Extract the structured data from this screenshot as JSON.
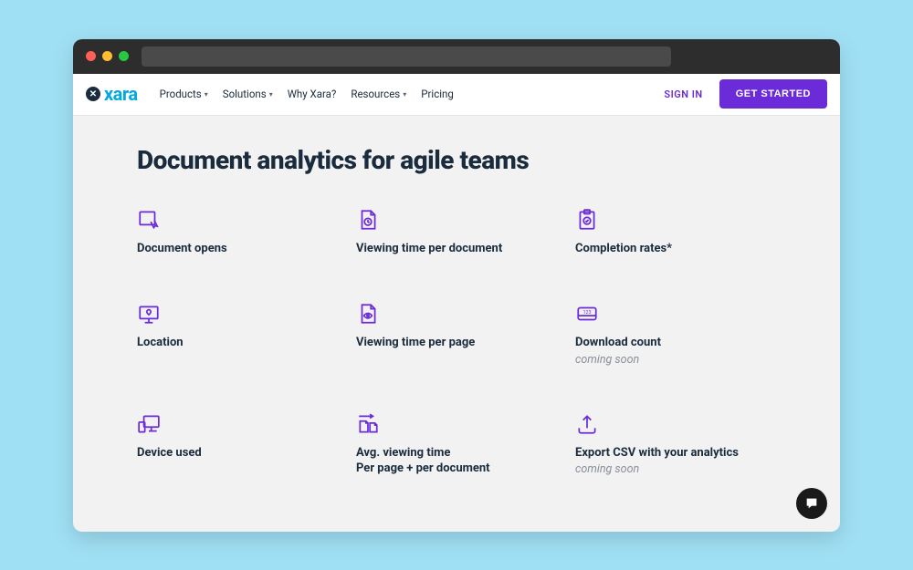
{
  "logo_text": "xara",
  "nav": {
    "products": "Products",
    "solutions": "Solutions",
    "why": "Why Xara?",
    "resources": "Resources",
    "pricing": "Pricing",
    "signin": "SIGN IN",
    "get_started": "GET STARTED"
  },
  "title": "Document analytics for agile teams",
  "features": {
    "f1": {
      "title": "Document opens"
    },
    "f2": {
      "title": "Viewing time per document"
    },
    "f3": {
      "title": "Completion rates*"
    },
    "f4": {
      "title": "Location"
    },
    "f5": {
      "title": "Viewing time per page"
    },
    "f6": {
      "title": "Download count",
      "note": "coming soon"
    },
    "f7": {
      "title": "Device used"
    },
    "f8": {
      "title": "Avg. viewing time",
      "subtitle": "Per page + per document"
    },
    "f9": {
      "title": "Export CSV with your analytics",
      "note": "coming soon"
    }
  }
}
